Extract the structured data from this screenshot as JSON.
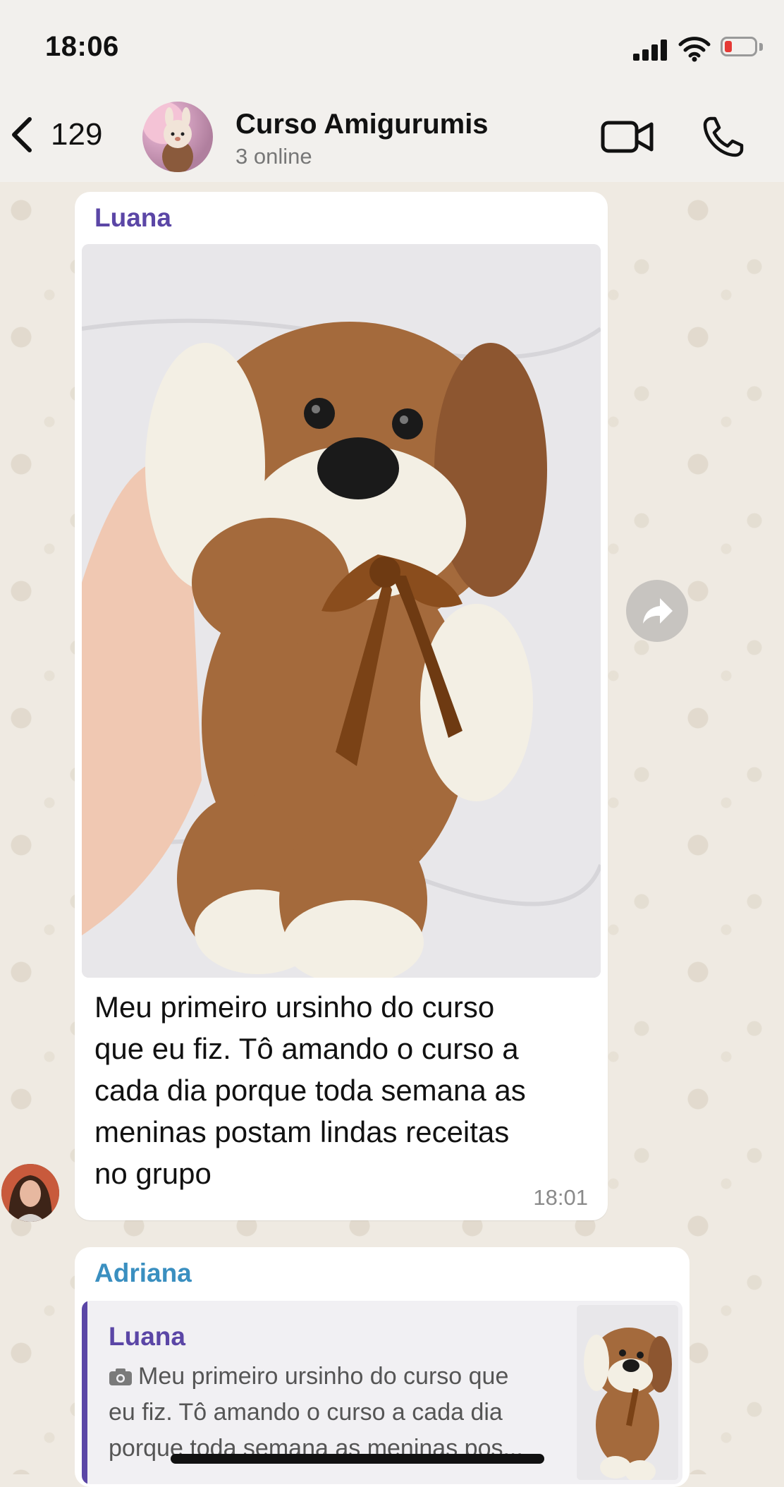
{
  "status_bar": {
    "time": "18:06"
  },
  "header": {
    "back_count": "129",
    "title": "Curso Amigurumis",
    "subtitle": "3 online"
  },
  "messages": [
    {
      "sender": "Luana",
      "sender_color": "#5b46a6",
      "caption_lines": [
        "Meu primeiro ursinho do curso",
        "que eu fiz. Tô amando o curso a",
        "cada dia porque toda semana as",
        "meninas postam lindas receitas",
        "no grupo"
      ],
      "time": "18:01"
    },
    {
      "sender": "Adriana",
      "sender_color": "#3a8fc0",
      "quote": {
        "sender": "Luana",
        "text_lines": [
          "Meu primeiro ursinho do curso que",
          "eu fiz. Tô amando o curso a cada dia",
          "porque toda semana as meninas pos..."
        ]
      }
    }
  ],
  "colors": {
    "accent_purple": "#5b46a6",
    "accent_blue": "#3a8fc0",
    "chat_background": "#efeae2",
    "battery_low": "#e53935"
  },
  "icons": [
    "back-chevron-icon",
    "video-call-icon",
    "phone-icon",
    "forward-icon",
    "camera-icon",
    "signal-icon",
    "wifi-icon",
    "battery-icon"
  ]
}
